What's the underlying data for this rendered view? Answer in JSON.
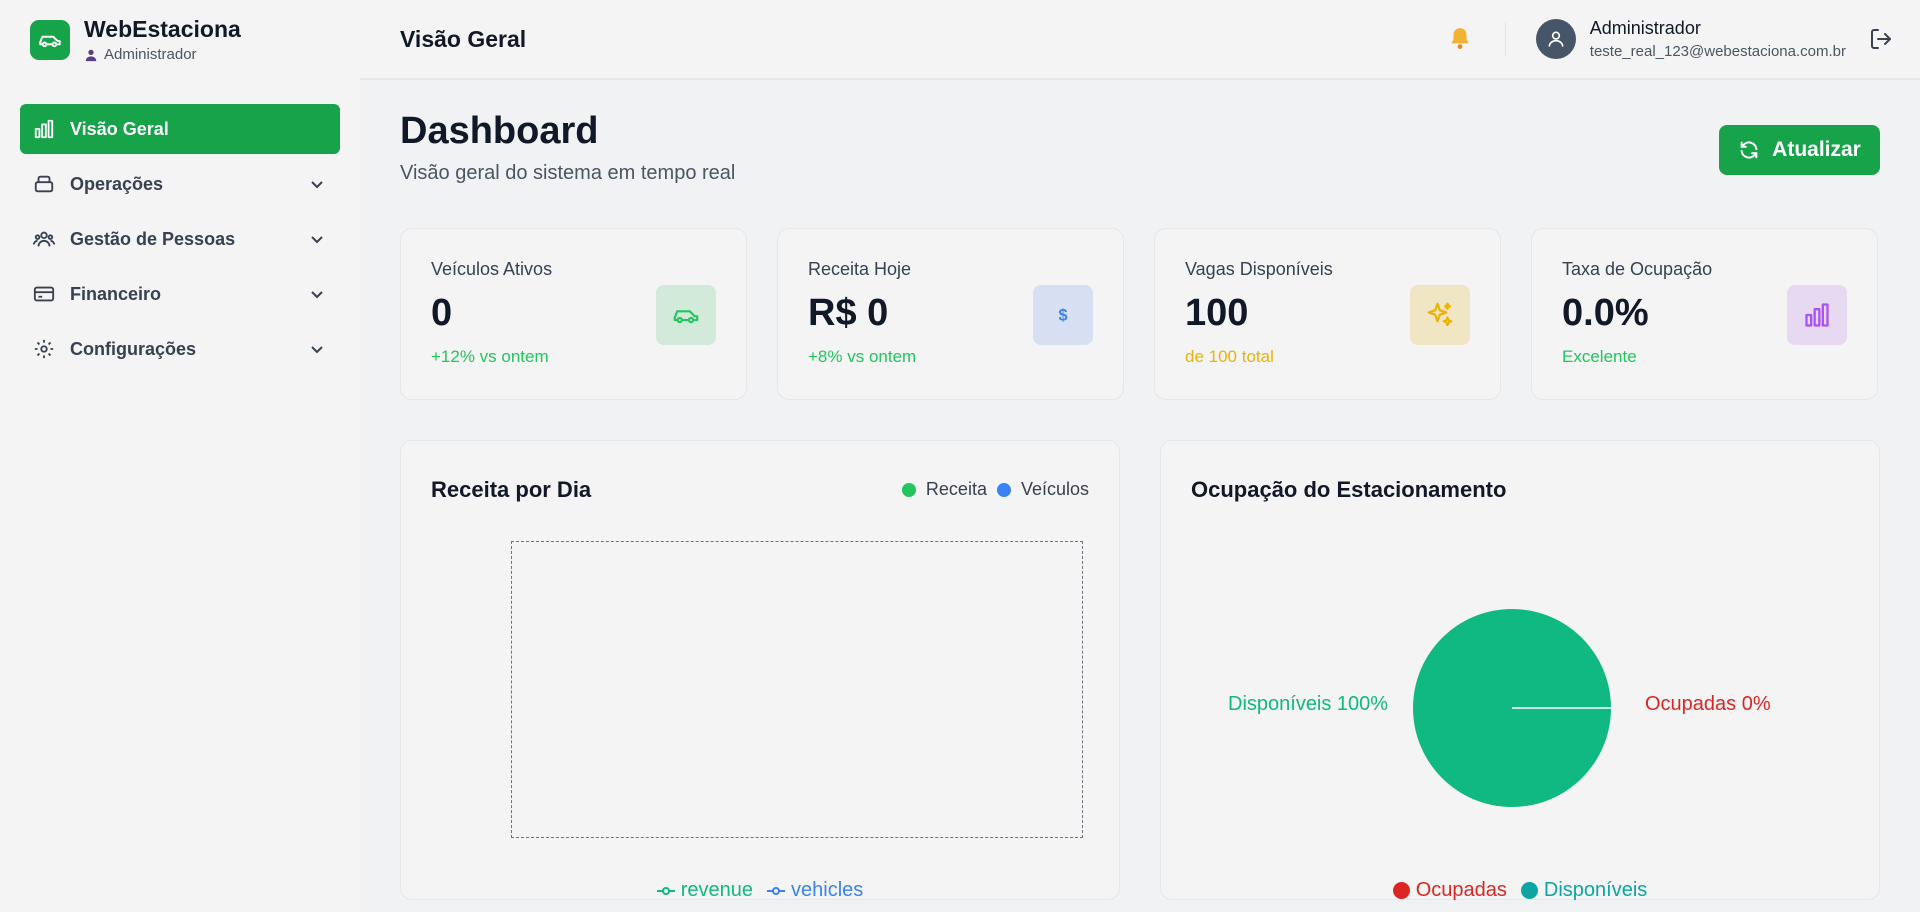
{
  "brand": {
    "name": "WebEstaciona",
    "role": "Administrador"
  },
  "sidebar": {
    "items": [
      {
        "label": "Visão Geral",
        "icon": "bar-chart-icon",
        "active": true
      },
      {
        "label": "Operações",
        "icon": "car-stack-icon"
      },
      {
        "label": "Gestão de Pessoas",
        "icon": "users-icon"
      },
      {
        "label": "Financeiro",
        "icon": "credit-card-icon"
      },
      {
        "label": "Configurações",
        "icon": "gear-icon"
      }
    ]
  },
  "header": {
    "title": "Visão Geral",
    "user_name": "Administrador",
    "user_email": "teste_real_123@webestaciona.com.br"
  },
  "page": {
    "title": "Dashboard",
    "subtitle": "Visão geral do sistema em tempo real",
    "refresh_label": "Atualizar"
  },
  "stats": [
    {
      "label": "Veículos Ativos",
      "value": "0",
      "note": "+12% vs ontem",
      "note_color": "#22c55e",
      "icon": "car-icon",
      "icon_bg": "#d1ead9"
    },
    {
      "label": "Receita Hoje",
      "value": "R$ 0",
      "note": "+8% vs ontem",
      "note_color": "#22c55e",
      "icon": "dollar-icon",
      "icon_bg": "#d6e0f2"
    },
    {
      "label": "Vagas Disponíveis",
      "value": "100",
      "note": "de 100 total",
      "note_color": "#eab308",
      "icon": "sparkle-icon",
      "icon_bg": "#f1e6c4"
    },
    {
      "label": "Taxa de Ocupação",
      "value": "0.0%",
      "note": "Excelente",
      "note_color": "#22c55e",
      "icon": "chart-bars-icon",
      "icon_bg": "#e7d9f2"
    }
  ],
  "revenue_chart": {
    "title": "Receita por Dia",
    "legend_top": [
      {
        "name": "Receita",
        "color": "#22c55e"
      },
      {
        "name": "Veículos",
        "color": "#3b82f6"
      }
    ],
    "legend_bottom": [
      {
        "name": "revenue",
        "color": "#10b981"
      },
      {
        "name": "vehicles",
        "color": "#3b82f6"
      }
    ]
  },
  "chart_data": {
    "type": "pie",
    "title": "Ocupação do Estacionamento",
    "labels": [
      "Ocupadas",
      "Disponíveis"
    ],
    "values": [
      0,
      100
    ],
    "colors": [
      "#dc2626",
      "#10b981"
    ],
    "slice_labels": [
      "Ocupadas 0%",
      "Disponíveis 100%"
    ],
    "legend": [
      {
        "name": "Ocupadas",
        "color": "#dc2626"
      },
      {
        "name": "Disponíveis",
        "color": "#0ea5a0"
      }
    ]
  }
}
